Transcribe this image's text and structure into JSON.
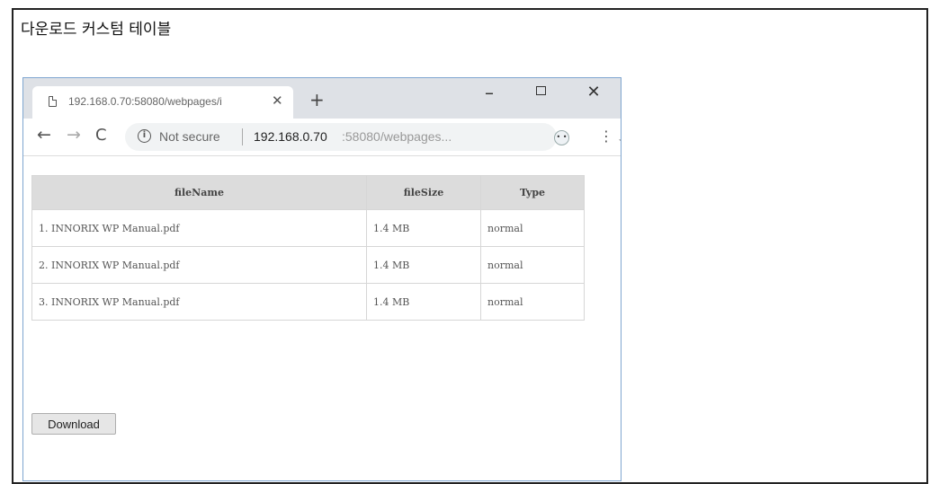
{
  "heading": "다운로드 커스텀 테이블",
  "browser": {
    "tab_title": "192.168.0.70:58080/webpages/i",
    "tab_close": "✕",
    "new_tab": "+",
    "window_controls": {
      "minimize": "–",
      "close": "✕"
    },
    "nav": {
      "back": "←",
      "forward": "→",
      "reload": "C"
    },
    "security_text": "Not secure",
    "url_host": "192.168.0.70",
    "url_rest": ":58080/webpages...",
    "star": "☆",
    "menu": "⋮"
  },
  "table": {
    "headers": [
      "fileName",
      "fileSize",
      "Type"
    ],
    "rows": [
      [
        "1. INNORIX WP Manual.pdf",
        "1.4 MB",
        "normal"
      ],
      [
        "2. INNORIX WP Manual.pdf",
        "1.4 MB",
        "normal"
      ],
      [
        "3. INNORIX WP Manual.pdf",
        "1.4 MB",
        "normal"
      ]
    ]
  },
  "download_button": "Download"
}
